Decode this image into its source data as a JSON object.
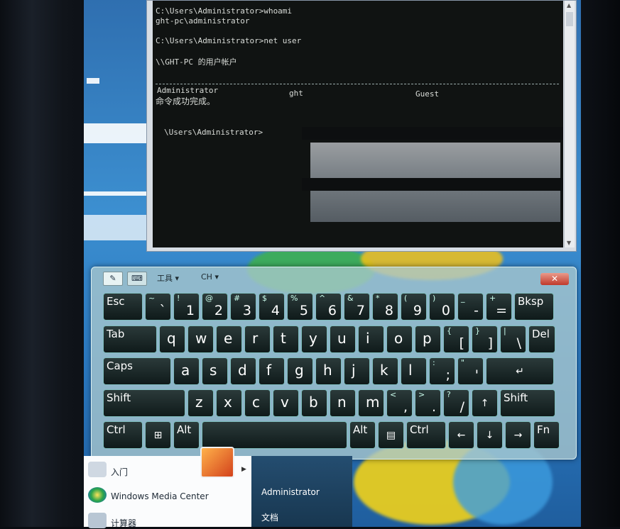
{
  "cmd": {
    "lines": [
      "C:\\Users\\Administrator>whoami",
      "ght-pc\\administrator",
      "",
      "C:\\Users\\Administrator>net user",
      "",
      "\\\\GHT-PC 的用户帐户",
      "",
      "",
      "-------------------------------------------------------------------------------"
    ],
    "accounts": [
      "Administrator",
      "ght",
      "Guest"
    ],
    "success": "命令成功完成。",
    "prompt": "\\Users\\Administrator>"
  },
  "osk": {
    "toolbar": {
      "tools": "工具",
      "lang": "CH"
    },
    "close_icon": "close-icon",
    "rows": [
      [
        {
          "name": "Esc"
        },
        {
          "main": "`",
          "shift": "~"
        },
        {
          "main": "1",
          "shift": "!"
        },
        {
          "main": "2",
          "shift": "@"
        },
        {
          "main": "3",
          "shift": "#"
        },
        {
          "main": "4",
          "shift": "$"
        },
        {
          "main": "5",
          "shift": "%"
        },
        {
          "main": "6",
          "shift": "^"
        },
        {
          "main": "7",
          "shift": "&"
        },
        {
          "main": "8",
          "shift": "*"
        },
        {
          "main": "9",
          "shift": "("
        },
        {
          "main": "0",
          "shift": ")"
        },
        {
          "main": "-",
          "shift": "_"
        },
        {
          "main": "=",
          "shift": "+"
        },
        {
          "name": "Bksp"
        }
      ],
      [
        {
          "name": "Tab"
        },
        {
          "main": "q"
        },
        {
          "main": "w"
        },
        {
          "main": "e"
        },
        {
          "main": "r"
        },
        {
          "main": "t"
        },
        {
          "main": "y"
        },
        {
          "main": "u"
        },
        {
          "main": "i"
        },
        {
          "main": "o"
        },
        {
          "main": "p"
        },
        {
          "main": "[",
          "shift": "{"
        },
        {
          "main": "]",
          "shift": "}"
        },
        {
          "main": "\\",
          "shift": "|"
        },
        {
          "name": "Del"
        }
      ],
      [
        {
          "name": "Caps"
        },
        {
          "main": "a"
        },
        {
          "main": "s"
        },
        {
          "main": "d"
        },
        {
          "main": "f"
        },
        {
          "main": "g"
        },
        {
          "main": "h"
        },
        {
          "main": "j"
        },
        {
          "main": "k"
        },
        {
          "main": "l"
        },
        {
          "main": ";",
          "shift": ":"
        },
        {
          "main": "'",
          "shift": "\""
        },
        {
          "name": "↵"
        }
      ],
      [
        {
          "name": "Shift"
        },
        {
          "main": "z"
        },
        {
          "main": "x"
        },
        {
          "main": "c"
        },
        {
          "main": "v"
        },
        {
          "main": "b"
        },
        {
          "main": "n"
        },
        {
          "main": "m"
        },
        {
          "main": ",",
          "shift": "<"
        },
        {
          "main": ".",
          "shift": ">"
        },
        {
          "main": "/",
          "shift": "?"
        },
        {
          "name": "↑"
        },
        {
          "name": "Shift"
        }
      ],
      [
        {
          "name": "Ctrl"
        },
        {
          "name": "⊞"
        },
        {
          "name": "Alt"
        },
        {
          "name": ""
        },
        {
          "name": "Alt"
        },
        {
          "name": "▤"
        },
        {
          "name": "Ctrl"
        },
        {
          "name": "←"
        },
        {
          "name": "↓"
        },
        {
          "name": "→"
        },
        {
          "name": "Fn"
        }
      ]
    ]
  },
  "startmenu": {
    "left_items": [
      "入门",
      "Windows Media Center",
      "计算器"
    ],
    "right_items": [
      "Administrator",
      "文档"
    ]
  }
}
